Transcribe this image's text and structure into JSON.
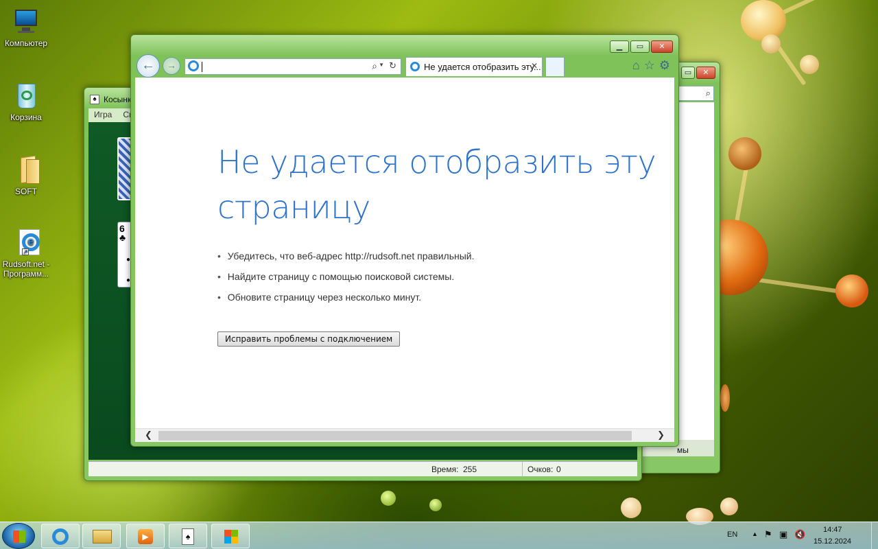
{
  "desktop": {
    "icons": [
      {
        "label": "Компьютер"
      },
      {
        "label": "Корзина"
      },
      {
        "label": "SOFT"
      },
      {
        "label": "Rudsoft.net - Программ..."
      }
    ]
  },
  "solitaire": {
    "title": "Косынка",
    "menu": [
      "Игра",
      "Справка"
    ],
    "card_rank": "6",
    "card_suit": "♣",
    "time_label": "Время:",
    "time_value": "255",
    "score_label": "Очков:",
    "score_value": "0"
  },
  "explorer": {
    "footer_text": "мы"
  },
  "browser": {
    "address_value": "",
    "tab_title": "Не удается отобразить эту...",
    "error_title": "Не удается отобразить эту страницу",
    "bullets": [
      "Убедитесь, что веб-адрес http://rudsoft.net правильный.",
      "Найдите страницу с помощью поисковой системы.",
      "Обновите страницу через несколько минут."
    ],
    "fix_button": "Исправить проблемы с подключением"
  },
  "taskbar": {
    "lang": "EN",
    "time": "14:47",
    "date": "15.12.2024"
  },
  "colors": {
    "error_title": "#2e72c9",
    "window_frame": "#7fc25a"
  }
}
